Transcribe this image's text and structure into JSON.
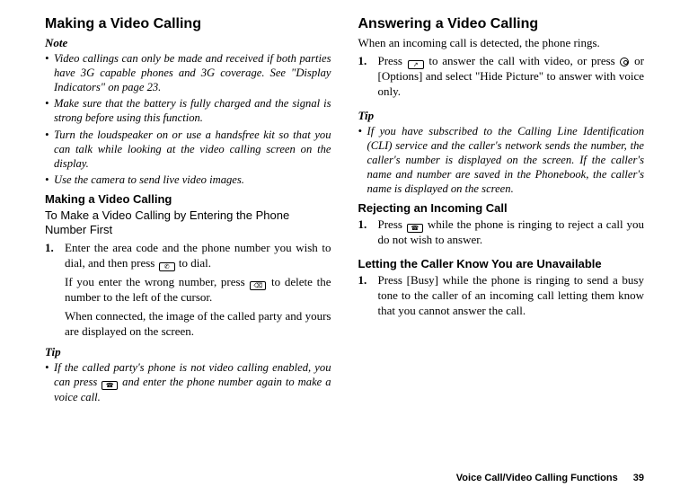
{
  "left": {
    "heading": "Making a Video Calling",
    "note_label": "Note",
    "notes": [
      "Video callings can only be made and received if both parties have 3G capable phones and 3G coverage. See \"Display Indicators\" on page 23.",
      "Make sure that the battery is fully charged and the signal is strong before using this function.",
      "Turn the loudspeaker on or use a handsfree kit so that you can talk while looking at the video calling screen on the display.",
      "Use the camera to send live video images."
    ],
    "sub_heading": "Making a Video Calling",
    "procedure_title": "To Make a Video Calling by Entering the Phone Number First",
    "step1_num": "1.",
    "step1_a": "Enter the area code and the phone number you wish to dial, and then press ",
    "step1_b": " to dial.",
    "step1_p2a": "If you enter the wrong number, press ",
    "step1_p2b": " to delete the number to the left of the cursor.",
    "step1_p3": "When connected, the image of the called party and yours are displayed on the screen.",
    "tip_label": "Tip",
    "tip1a": "If the called party's phone is not video calling enabled, you can press ",
    "tip1b": " and enter the phone number again to make a voice call."
  },
  "right": {
    "heading": "Answering a Video Calling",
    "intro": "When an incoming call is detected, the phone rings.",
    "step1_num": "1.",
    "step1_a": "Press ",
    "step1_b": " to answer the call with video, or press ",
    "step1_c": " or [Options] and select \"Hide Picture\" to answer with voice only.",
    "tip_label": "Tip",
    "tip_text": "If you have subscribed to the Calling Line Identification (CLI) service and the caller's network sends the number, the caller's number is displayed on the screen. If the caller's name and number are saved in the Phonebook, the caller's name is displayed on the screen.",
    "reject_heading": "Rejecting an Incoming Call",
    "reject_num": "1.",
    "reject_a": "Press ",
    "reject_b": " while the phone is ringing to reject a call you do not wish to answer.",
    "unavail_heading": "Letting the Caller Know You are Unavailable",
    "unavail_num": "1.",
    "unavail_text": "Press [Busy] while the phone is ringing to send a busy tone to the caller of an incoming call letting them know that you cannot answer the call."
  },
  "footer": {
    "title": "Voice Call/Video Calling Functions",
    "page": "39"
  }
}
